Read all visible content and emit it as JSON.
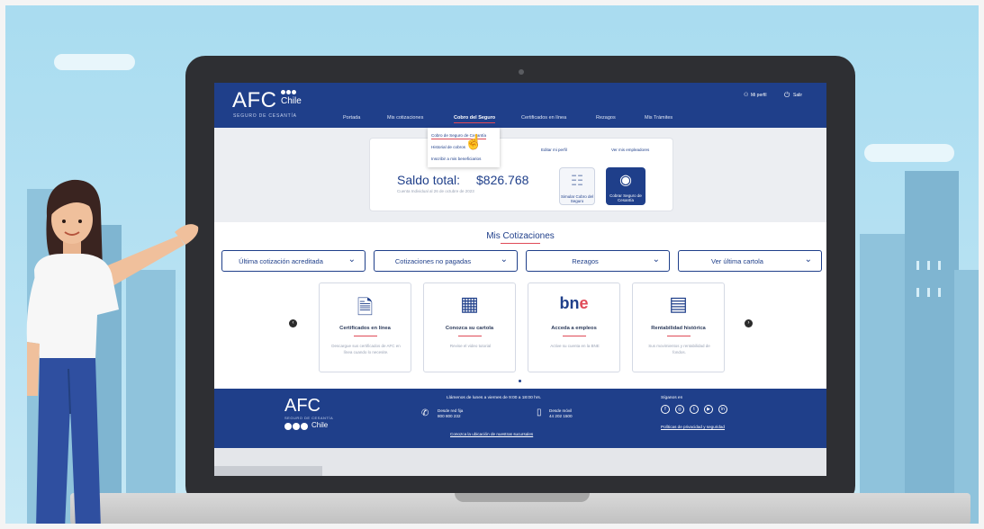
{
  "header": {
    "logo_text": "AFC",
    "logo_chile": "Chile",
    "logo_subtitle": "SEGURO DE CESANTÍA",
    "user_label": "Mi perfil",
    "exit_label": "Salir",
    "user_icon": "user-icon",
    "power_icon": "power-icon"
  },
  "nav": {
    "items": [
      {
        "label": "Portada"
      },
      {
        "label": "Mis cotizaciones"
      },
      {
        "label": "Cobro del Seguro"
      },
      {
        "label": "Certificados en línea"
      },
      {
        "label": "Rezagos"
      },
      {
        "label": "Mis Trámites"
      }
    ]
  },
  "dropdown": {
    "items": [
      {
        "label": "Cobro de Seguro de Cesantía"
      },
      {
        "label": "Historial de cobros"
      },
      {
        "label": "Inscribir a mis beneficiarios"
      }
    ]
  },
  "saldo": {
    "edit_link": "Editar mi perfil",
    "see_link": "Ver mis empleadores",
    "label": "Saldo total:",
    "value": "$826.768",
    "date_text": "Cuenta Individual al 26 de octubre de 2023",
    "simular_label": "Simular Cobro del Seguro",
    "cobrar_label": "Cobrar Seguro de Cesantía"
  },
  "cotizaciones": {
    "title": "Mis Cotizaciones",
    "selects": [
      {
        "label": "Última cotización acreditada"
      },
      {
        "label": "Cotizaciones no pagadas"
      },
      {
        "label": "Rezagos"
      },
      {
        "label": "Ver última cartola"
      }
    ]
  },
  "tiles": [
    {
      "title": "Certificados en línea",
      "desc": "Descargue sus certificados de AFC en línea cuando lo necesite.",
      "icon": "document-icon"
    },
    {
      "title": "Conozca su cartola",
      "desc": "Revise el video tutorial",
      "icon": "cartola-icon"
    },
    {
      "title": "Acceda a empleos",
      "desc": "Active su cuenta en la BNE",
      "icon": "bne-logo",
      "logo_text_a": "bn",
      "logo_text_b": "e"
    },
    {
      "title": "Rentabilidad histórica",
      "desc": "Sus movimientos y rentabilidad de fondos.",
      "icon": "bar-chart-icon"
    }
  ],
  "footer": {
    "logo_text": "AFC",
    "logo_subtitle": "SEGURO DE CESANTÍA",
    "logo_chile": "Chile",
    "call_text": "Llámenos de lunes a viernes de 9:00 a 18:00 hrs.",
    "fijo_label": "Desde red fija",
    "fijo_number": "800 800 232",
    "movil_label": "Desde móvil",
    "movil_number": "44 202 1500",
    "branch_link": "Conozca la ubicación de nuestras sucursales",
    "follow_label": "Síganos en",
    "privacy_link": "Políticas de privacidad y seguridad",
    "social": [
      "f",
      "◎",
      "t",
      "▶",
      "in"
    ]
  }
}
